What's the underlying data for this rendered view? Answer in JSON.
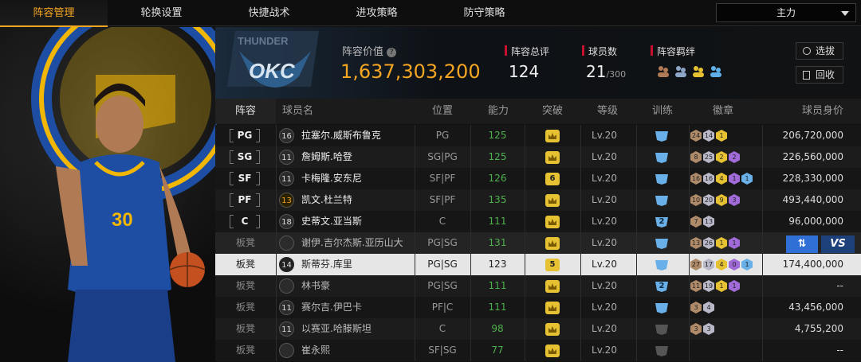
{
  "tabs": [
    "阵容管理",
    "轮换设置",
    "快捷战术",
    "进攻策略",
    "防守策略"
  ],
  "lineup_select": "主力",
  "team": {
    "logo_text": "OKC",
    "logo_arc": "THUNDER"
  },
  "header": {
    "value_label": "阵容价值",
    "value": "1,637,303,200",
    "rating_label": "阵容总评",
    "rating": "124",
    "count_label": "球员数",
    "count": "21",
    "count_max": "/300",
    "synergy_label": "阵容羁绊",
    "btn_select": "选拔",
    "btn_recycle": "回收"
  },
  "columns": [
    "阵容",
    "球员名",
    "位置",
    "能力",
    "突破",
    "等级",
    "训练",
    "徽章",
    "球员身价"
  ],
  "accent": "#f5a623",
  "players": [
    {
      "slot": "PG",
      "bench": false,
      "num": "16",
      "name": "拉塞尔.威斯布鲁克",
      "position": "PG",
      "ability": "125",
      "breakthrough": "",
      "level": "Lv.20",
      "train": "",
      "badges": [
        "24",
        "14",
        "1"
      ],
      "value": "206,720,000"
    },
    {
      "slot": "SG",
      "bench": false,
      "num": "11",
      "name": "詹姆斯.哈登",
      "position": "SG|PG",
      "ability": "125",
      "breakthrough": "",
      "level": "Lv.20",
      "train": "",
      "badges": [
        "8",
        "25",
        "2",
        "2"
      ],
      "value": "226,560,000"
    },
    {
      "slot": "SF",
      "bench": false,
      "num": "11",
      "name": "卡梅隆.安东尼",
      "position": "SF|PF",
      "ability": "126",
      "breakthrough": "6",
      "level": "Lv.20",
      "train": "",
      "badges": [
        "16",
        "16",
        "4",
        "1",
        "1"
      ],
      "value": "228,330,000"
    },
    {
      "slot": "PF",
      "bench": false,
      "num": "13",
      "name": "凯文.杜兰特",
      "position": "SF|PF",
      "ability": "135",
      "breakthrough": "",
      "level": "Lv.20",
      "train": "",
      "badges": [
        "10",
        "20",
        "9",
        "3"
      ],
      "value": "493,440,000"
    },
    {
      "slot": "C",
      "bench": false,
      "num": "18",
      "name": "史蒂文.亚当斯",
      "position": "C",
      "ability": "111",
      "breakthrough": "",
      "level": "Lv.20",
      "train": "2",
      "badges": [
        "7",
        "13"
      ],
      "value": "96,000,000"
    },
    {
      "slot": "板凳",
      "bench": true,
      "num": "",
      "name": "谢伊.吉尔杰斯.亚历山大",
      "position": "PG|SG",
      "ability": "131",
      "breakthrough": "",
      "level": "Lv.20",
      "train": "",
      "badges": [
        "13",
        "26",
        "1",
        "1"
      ],
      "value": "VS"
    },
    {
      "slot": "板凳",
      "bench": true,
      "num": "14",
      "name": "斯蒂芬.库里",
      "position": "PG|SG",
      "ability": "123",
      "breakthrough": "5",
      "level": "Lv.20",
      "train": "",
      "badges": [
        "27",
        "17",
        "4",
        "0",
        "1"
      ],
      "value": "174,400,000"
    },
    {
      "slot": "板凳",
      "bench": true,
      "num": "",
      "name": "林书豪",
      "position": "PG|SG",
      "ability": "111",
      "breakthrough": "",
      "level": "Lv.20",
      "train": "2",
      "badges": [
        "11",
        "19",
        "1",
        "1"
      ],
      "value": "--"
    },
    {
      "slot": "板凳",
      "bench": true,
      "num": "11",
      "name": "赛尔吉.伊巴卡",
      "position": "PF|C",
      "ability": "111",
      "breakthrough": "",
      "level": "Lv.20",
      "train": "",
      "badges": [
        "3",
        "4"
      ],
      "value": "43,456,000"
    },
    {
      "slot": "板凳",
      "bench": true,
      "num": "11",
      "name": "以赛亚.哈滕斯坦",
      "position": "C",
      "ability": "98",
      "breakthrough": "",
      "level": "Lv.20",
      "train": "",
      "badges": [
        "3",
        "3"
      ],
      "value": "4,755,200"
    },
    {
      "slot": "板凳",
      "bench": true,
      "num": "",
      "name": "崔永熙",
      "position": "SF|SG",
      "ability": "77",
      "breakthrough": "",
      "level": "Lv.20",
      "train": "",
      "badges": [],
      "value": "--"
    }
  ]
}
